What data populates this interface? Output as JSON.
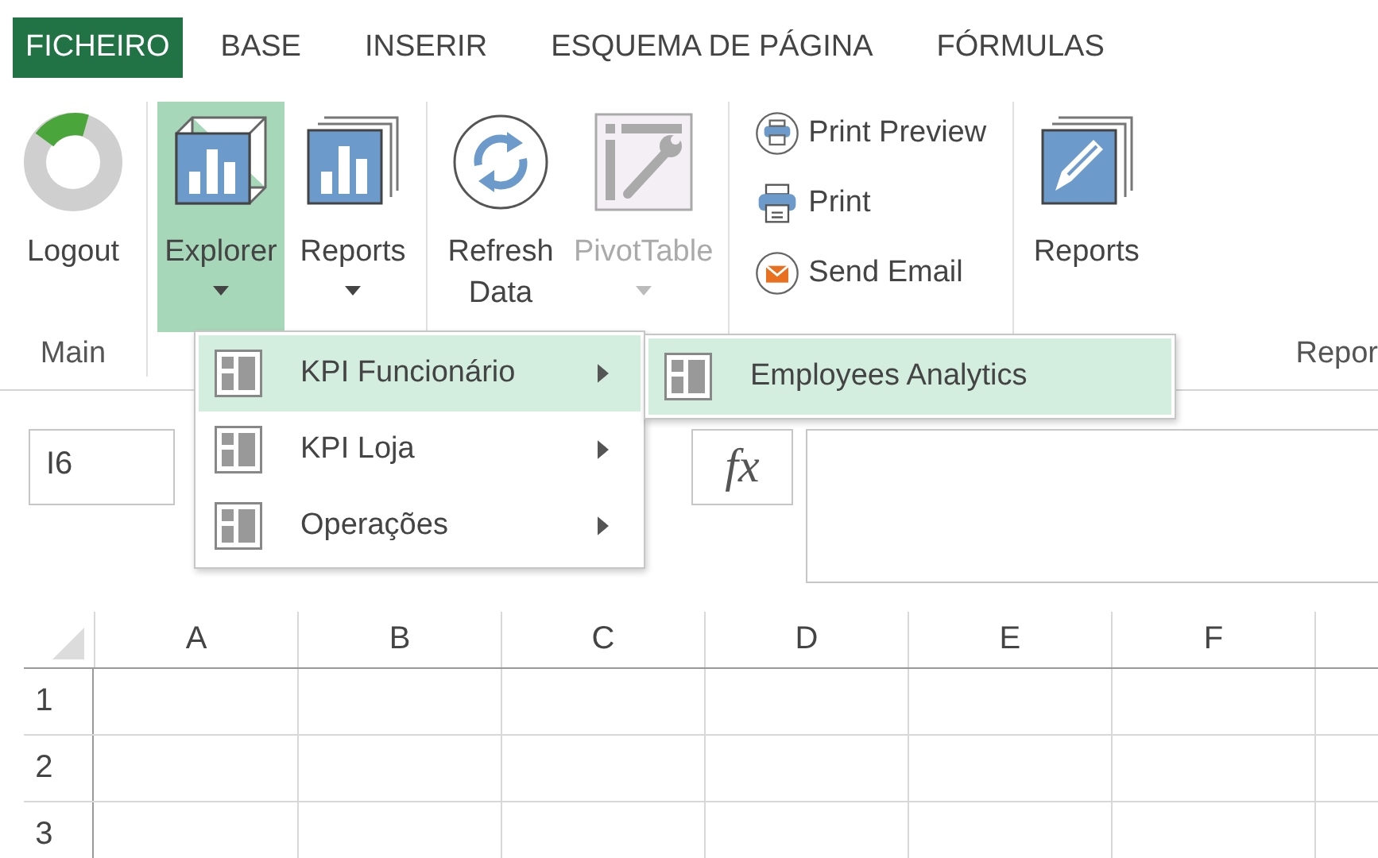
{
  "tabs": [
    {
      "label": "FICHEIRO",
      "selected": true
    },
    {
      "label": "BASE",
      "selected": false
    },
    {
      "label": "INSERIR",
      "selected": false
    },
    {
      "label": "ESQUEMA DE PÁGINA",
      "selected": false
    },
    {
      "label": "FÓRMULAS",
      "selected": false
    }
  ],
  "ribbon": {
    "groups": [
      {
        "label": "Main",
        "buttons": [
          {
            "kind": "large",
            "label": "Logout",
            "pressed": false,
            "disabled": false,
            "dropdown": false
          }
        ]
      },
      {
        "buttons": [
          {
            "kind": "large",
            "label": "Explorer",
            "pressed": true,
            "disabled": false,
            "dropdown": true
          },
          {
            "kind": "large",
            "label": "Reports",
            "pressed": false,
            "disabled": false,
            "dropdown": true
          }
        ]
      },
      {
        "buttons": [
          {
            "kind": "large",
            "label": "Refresh Data",
            "pressed": false,
            "disabled": false,
            "dropdown": false
          },
          {
            "kind": "large",
            "label": "PivotTable",
            "pressed": false,
            "disabled": true,
            "dropdown": true
          }
        ]
      },
      {
        "buttons": [
          {
            "kind": "small",
            "label": "Print Preview"
          },
          {
            "kind": "small",
            "label": "Print"
          },
          {
            "kind": "small",
            "label": "Send Email"
          }
        ]
      },
      {
        "label": "Repor",
        "buttons": [
          {
            "kind": "large",
            "label": "Reports",
            "pressed": false,
            "disabled": false,
            "dropdown": false
          }
        ]
      }
    ]
  },
  "menu": {
    "items": [
      {
        "label": "KPI Funcionário",
        "selected": true,
        "submenu": true
      },
      {
        "label": "KPI Loja",
        "selected": false,
        "submenu": true
      },
      {
        "label": "Operações",
        "selected": false,
        "submenu": true
      }
    ]
  },
  "submenu": {
    "items": [
      {
        "label": "Employees Analytics",
        "selected": true
      }
    ]
  },
  "formula_bar": {
    "name_box": "I6",
    "fx": "fx"
  },
  "sheet": {
    "columns": [
      "A",
      "B",
      "C",
      "D",
      "E",
      "F"
    ],
    "rows": [
      "1",
      "2",
      "3"
    ]
  }
}
